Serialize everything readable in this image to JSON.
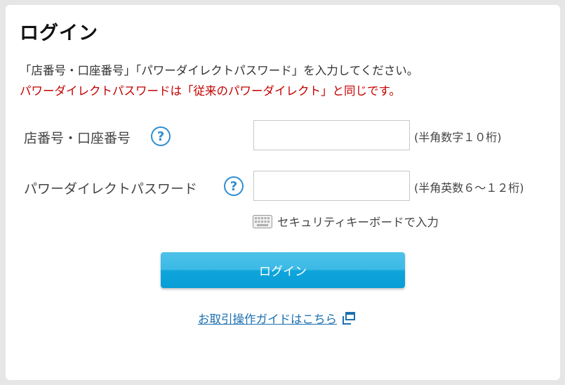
{
  "page": {
    "title": "ログイン",
    "instruction": "「店番号・口座番号」「パワーダイレクトパスワード」を入力してください。",
    "notice": "パワーダイレクトパスワードは「従来のパワーダイレクト」と同じです。",
    "notice_color": "#c40000"
  },
  "fields": {
    "account": {
      "label": "店番号・口座番号",
      "help_glyph": "?",
      "value": "",
      "placeholder": "",
      "hint": "(半角数字１０桁)"
    },
    "password": {
      "label": "パワーダイレクトパスワード",
      "help_glyph": "?",
      "value": "",
      "placeholder": "",
      "hint": "(半角英数６～１２桁)"
    }
  },
  "security_keyboard": {
    "label": "セキュリティキーボードで入力",
    "icon": "keyboard-icon"
  },
  "login_button": {
    "label": "ログイン",
    "color": "#0ea5db"
  },
  "guide_link": {
    "label": "お取引操作ガイドはこちら",
    "icon": "external-window-icon",
    "color": "#1a6fb0"
  },
  "colors": {
    "accent": "#2f8ed0",
    "background": "#e6e6e6"
  }
}
